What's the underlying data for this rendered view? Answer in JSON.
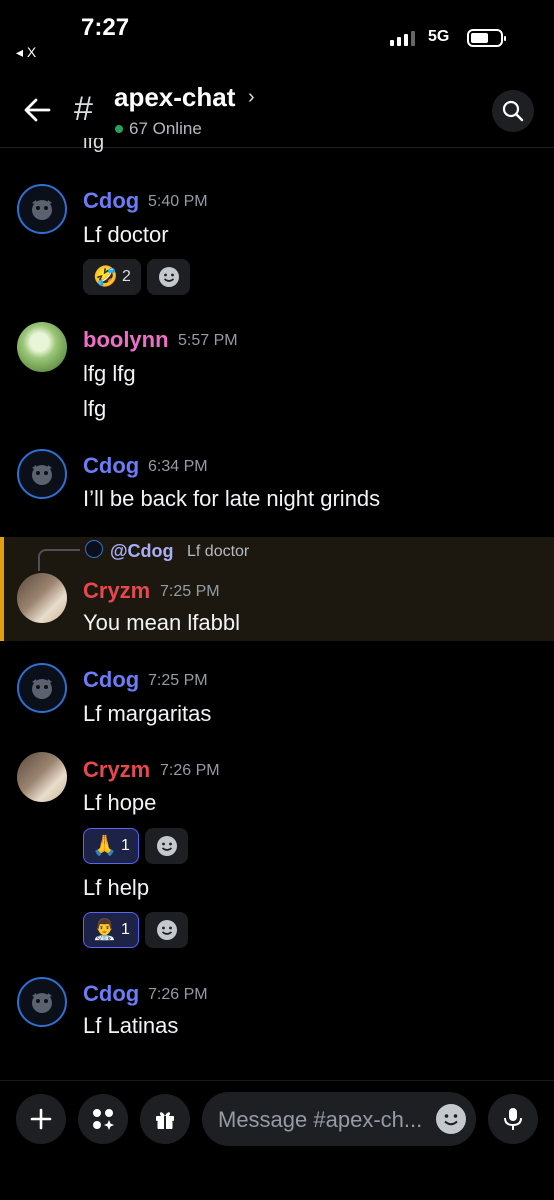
{
  "status_bar": {
    "time": "7:27",
    "back_label": "◂ X",
    "network": "5G"
  },
  "header": {
    "channel": "apex-chat",
    "online": "67 Online"
  },
  "cut_text": "lfg",
  "messages": [
    {
      "user": "Cdog",
      "time": "5:40 PM",
      "lines": [
        "Lf doctor"
      ]
    },
    {
      "user": "boolynn",
      "time": "5:57 PM",
      "lines": [
        "lfg lfg",
        "lfg"
      ]
    },
    {
      "user": "Cdog",
      "time": "6:34 PM",
      "lines": [
        "I’ll be back for late night grinds"
      ]
    },
    {
      "user": "Cryzm",
      "time": "7:25 PM",
      "lines": [
        "You mean lfabbl"
      ],
      "reply_to": {
        "user": "@Cdog",
        "text": "Lf doctor"
      }
    },
    {
      "user": "Cdog",
      "time": "7:25 PM",
      "lines": [
        "Lf margaritas"
      ]
    },
    {
      "user": "Cryzm",
      "time": "7:26 PM",
      "lines": [
        "Lf hope",
        "Lf help"
      ]
    },
    {
      "user": "Cdog",
      "time": "7:26 PM",
      "lines": [
        "Lf Latinas"
      ]
    }
  ],
  "reactions": {
    "doctor": {
      "emoji": "🤣",
      "count": "2"
    },
    "hope": {
      "emoji": "🙏",
      "count": "1"
    },
    "help": {
      "emoji": "👨‍⚕️",
      "count": "1"
    }
  },
  "composer": {
    "placeholder": "Message #apex-ch..."
  },
  "colors": {
    "cdog": "#6b7cf5",
    "boolynn": "#ee6fc7",
    "cryzm": "#e5484d",
    "reply_highlight": "#e1a10f"
  }
}
